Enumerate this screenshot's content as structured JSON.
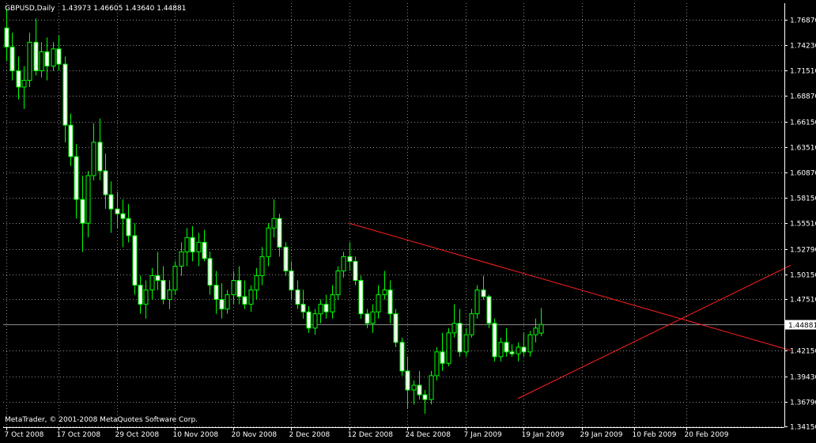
{
  "chart_data": {
    "type": "candlestick",
    "symbol_label": "GBPUSD,Daily",
    "ohlc_label": "1.43973 1.46605 1.43640 1.44881",
    "copyright": "MetaTrader, © 2001-2008 MetaQuotes Software Corp.",
    "current_price": 1.44881,
    "current_price_label": "1.44881",
    "grid": true,
    "ylim": [
      1.341,
      1.786
    ],
    "y_ticks": [
      {
        "value": 1.7687,
        "label": "1.76870"
      },
      {
        "value": 1.7423,
        "label": "1.74230"
      },
      {
        "value": 1.7151,
        "label": "1.71510"
      },
      {
        "value": 1.6887,
        "label": "1.68870"
      },
      {
        "value": 1.6615,
        "label": "1.66150"
      },
      {
        "value": 1.6351,
        "label": "1.63510"
      },
      {
        "value": 1.6087,
        "label": "1.60870"
      },
      {
        "value": 1.5815,
        "label": "1.58150"
      },
      {
        "value": 1.5551,
        "label": "1.55510"
      },
      {
        "value": 1.5279,
        "label": "1.52790"
      },
      {
        "value": 1.5015,
        "label": "1.50150"
      },
      {
        "value": 1.4751,
        "label": "1.47510"
      },
      {
        "value": 1.4215,
        "label": "1.42150"
      },
      {
        "value": 1.3943,
        "label": "1.39430"
      },
      {
        "value": 1.3679,
        "label": "1.36790"
      },
      {
        "value": 1.3415,
        "label": "1.34150"
      }
    ],
    "x_ticks": [
      {
        "index": 0,
        "label": "7 Oct 2008"
      },
      {
        "index": 9,
        "label": "17 Oct 2008"
      },
      {
        "index": 19,
        "label": "29 Oct 2008"
      },
      {
        "index": 29,
        "label": "10 Nov 2008"
      },
      {
        "index": 39,
        "label": "20 Nov 2008"
      },
      {
        "index": 49,
        "label": "2 Dec 2008"
      },
      {
        "index": 59,
        "label": "12 Dec 2008"
      },
      {
        "index": 69,
        "label": "24 Dec 2008"
      },
      {
        "index": 79,
        "label": "7 Jan 2009"
      },
      {
        "index": 89,
        "label": "19 Jan 2009"
      },
      {
        "index": 99,
        "label": "29 Jan 2009"
      },
      {
        "index": 108,
        "label": "10 Feb 2009"
      },
      {
        "index": 117,
        "label": "20 Feb 2009"
      }
    ],
    "candles": [
      [
        1.76,
        1.78,
        1.725,
        1.74
      ],
      [
        1.74,
        1.755,
        1.705,
        1.715
      ],
      [
        1.715,
        1.73,
        1.685,
        1.698
      ],
      [
        1.698,
        1.72,
        1.675,
        1.705
      ],
      [
        1.705,
        1.755,
        1.698,
        1.745
      ],
      [
        1.745,
        1.77,
        1.71,
        1.715
      ],
      [
        1.715,
        1.745,
        1.708,
        1.735
      ],
      [
        1.735,
        1.75,
        1.705,
        1.72
      ],
      [
        1.72,
        1.745,
        1.715,
        1.738
      ],
      [
        1.738,
        1.752,
        1.715,
        1.722
      ],
      [
        1.722,
        1.73,
        1.64,
        1.658
      ],
      [
        1.658,
        1.67,
        1.615,
        1.625
      ],
      [
        1.625,
        1.638,
        1.56,
        1.58
      ],
      [
        1.58,
        1.605,
        1.525,
        1.555
      ],
      [
        1.555,
        1.61,
        1.54,
        1.605
      ],
      [
        1.605,
        1.66,
        1.6,
        1.64
      ],
      [
        1.64,
        1.665,
        1.6,
        1.61
      ],
      [
        1.61,
        1.628,
        1.57,
        1.585
      ],
      [
        1.585,
        1.599,
        1.545,
        1.57
      ],
      [
        1.57,
        1.588,
        1.55,
        1.565
      ],
      [
        1.565,
        1.58,
        1.53,
        1.56
      ],
      [
        1.56,
        1.575,
        1.535,
        1.542
      ],
      [
        1.542,
        1.555,
        1.48,
        1.49
      ],
      [
        1.49,
        1.5,
        1.46,
        1.47
      ],
      [
        1.47,
        1.495,
        1.455,
        1.485
      ],
      [
        1.485,
        1.508,
        1.475,
        1.5
      ],
      [
        1.5,
        1.525,
        1.485,
        1.495
      ],
      [
        1.495,
        1.51,
        1.47,
        1.475
      ],
      [
        1.475,
        1.495,
        1.465,
        1.485
      ],
      [
        1.485,
        1.515,
        1.48,
        1.51
      ],
      [
        1.51,
        1.535,
        1.5,
        1.525
      ],
      [
        1.525,
        1.55,
        1.51,
        1.54
      ],
      [
        1.54,
        1.552,
        1.515,
        1.525
      ],
      [
        1.525,
        1.545,
        1.51,
        1.535
      ],
      [
        1.535,
        1.548,
        1.515,
        1.518
      ],
      [
        1.518,
        1.525,
        1.48,
        1.49
      ],
      [
        1.49,
        1.505,
        1.46,
        1.475
      ],
      [
        1.475,
        1.492,
        1.455,
        1.465
      ],
      [
        1.465,
        1.485,
        1.46,
        1.48
      ],
      [
        1.48,
        1.505,
        1.47,
        1.495
      ],
      [
        1.495,
        1.51,
        1.47,
        1.478
      ],
      [
        1.478,
        1.495,
        1.465,
        1.47
      ],
      [
        1.47,
        1.49,
        1.462,
        1.485
      ],
      [
        1.485,
        1.508,
        1.475,
        1.5
      ],
      [
        1.5,
        1.53,
        1.49,
        1.52
      ],
      [
        1.52,
        1.555,
        1.51,
        1.55
      ],
      [
        1.55,
        1.58,
        1.54,
        1.56
      ],
      [
        1.56,
        1.565,
        1.52,
        1.53
      ],
      [
        1.53,
        1.535,
        1.5,
        1.505
      ],
      [
        1.505,
        1.515,
        1.475,
        1.485
      ],
      [
        1.485,
        1.495,
        1.465,
        1.47
      ],
      [
        1.47,
        1.485,
        1.455,
        1.462
      ],
      [
        1.462,
        1.468,
        1.44,
        1.445
      ],
      [
        1.445,
        1.465,
        1.438,
        1.46
      ],
      [
        1.46,
        1.475,
        1.45,
        1.47
      ],
      [
        1.47,
        1.48,
        1.455,
        1.462
      ],
      [
        1.462,
        1.49,
        1.455,
        1.48
      ],
      [
        1.48,
        1.51,
        1.475,
        1.505
      ],
      [
        1.505,
        1.525,
        1.498,
        1.52
      ],
      [
        1.52,
        1.535,
        1.505,
        1.515
      ],
      [
        1.515,
        1.52,
        1.49,
        1.495
      ],
      [
        1.495,
        1.5,
        1.455,
        1.46
      ],
      [
        1.46,
        1.465,
        1.445,
        1.45
      ],
      [
        1.45,
        1.47,
        1.44,
        1.462
      ],
      [
        1.462,
        1.49,
        1.455,
        1.48
      ],
      [
        1.48,
        1.505,
        1.475,
        1.485
      ],
      [
        1.485,
        1.495,
        1.45,
        1.46
      ],
      [
        1.46,
        1.465,
        1.425,
        1.43
      ],
      [
        1.43,
        1.435,
        1.395,
        1.4
      ],
      [
        1.4,
        1.415,
        1.36,
        1.38
      ],
      [
        1.38,
        1.39,
        1.365,
        1.385
      ],
      [
        1.385,
        1.4,
        1.37,
        1.375
      ],
      [
        1.375,
        1.38,
        1.355,
        1.37
      ],
      [
        1.37,
        1.4,
        1.365,
        1.395
      ],
      [
        1.395,
        1.425,
        1.39,
        1.42
      ],
      [
        1.42,
        1.44,
        1.4,
        1.408
      ],
      [
        1.408,
        1.445,
        1.405,
        1.44
      ],
      [
        1.44,
        1.47,
        1.435,
        1.45
      ],
      [
        1.45,
        1.465,
        1.415,
        1.42
      ],
      [
        1.42,
        1.445,
        1.415,
        1.438
      ],
      [
        1.438,
        1.465,
        1.435,
        1.46
      ],
      [
        1.46,
        1.49,
        1.455,
        1.485
      ],
      [
        1.485,
        1.5,
        1.475,
        1.478
      ],
      [
        1.478,
        1.48,
        1.445,
        1.45
      ],
      [
        1.45,
        1.455,
        1.41,
        1.415
      ],
      [
        1.415,
        1.435,
        1.41,
        1.43
      ],
      [
        1.43,
        1.445,
        1.415,
        1.42
      ],
      [
        1.42,
        1.428,
        1.415,
        1.418
      ],
      [
        1.418,
        1.43,
        1.41,
        1.425
      ],
      [
        1.425,
        1.44,
        1.415,
        1.42
      ],
      [
        1.42,
        1.442,
        1.415,
        1.438
      ],
      [
        1.438,
        1.455,
        1.43,
        1.445
      ],
      [
        1.4397,
        1.4661,
        1.4364,
        1.4488
      ]
    ],
    "trendlines": [
      {
        "color": "#ff2020",
        "start": {
          "index": 59,
          "price": 1.555
        },
        "end": {
          "index": 135,
          "price": 1.4215
        }
      },
      {
        "color": "#ff2020",
        "start": {
          "index": 88,
          "price": 1.371
        },
        "end": {
          "index": 135,
          "price": 1.511
        }
      }
    ],
    "colors": {
      "background": "#000000",
      "grid": "#8a8a8a",
      "candle": "#00ff00",
      "bull_body": "#000000",
      "bear_body": "#ffffff",
      "axis_text": "#ffffff",
      "price_line": "#8a8a8a"
    }
  }
}
